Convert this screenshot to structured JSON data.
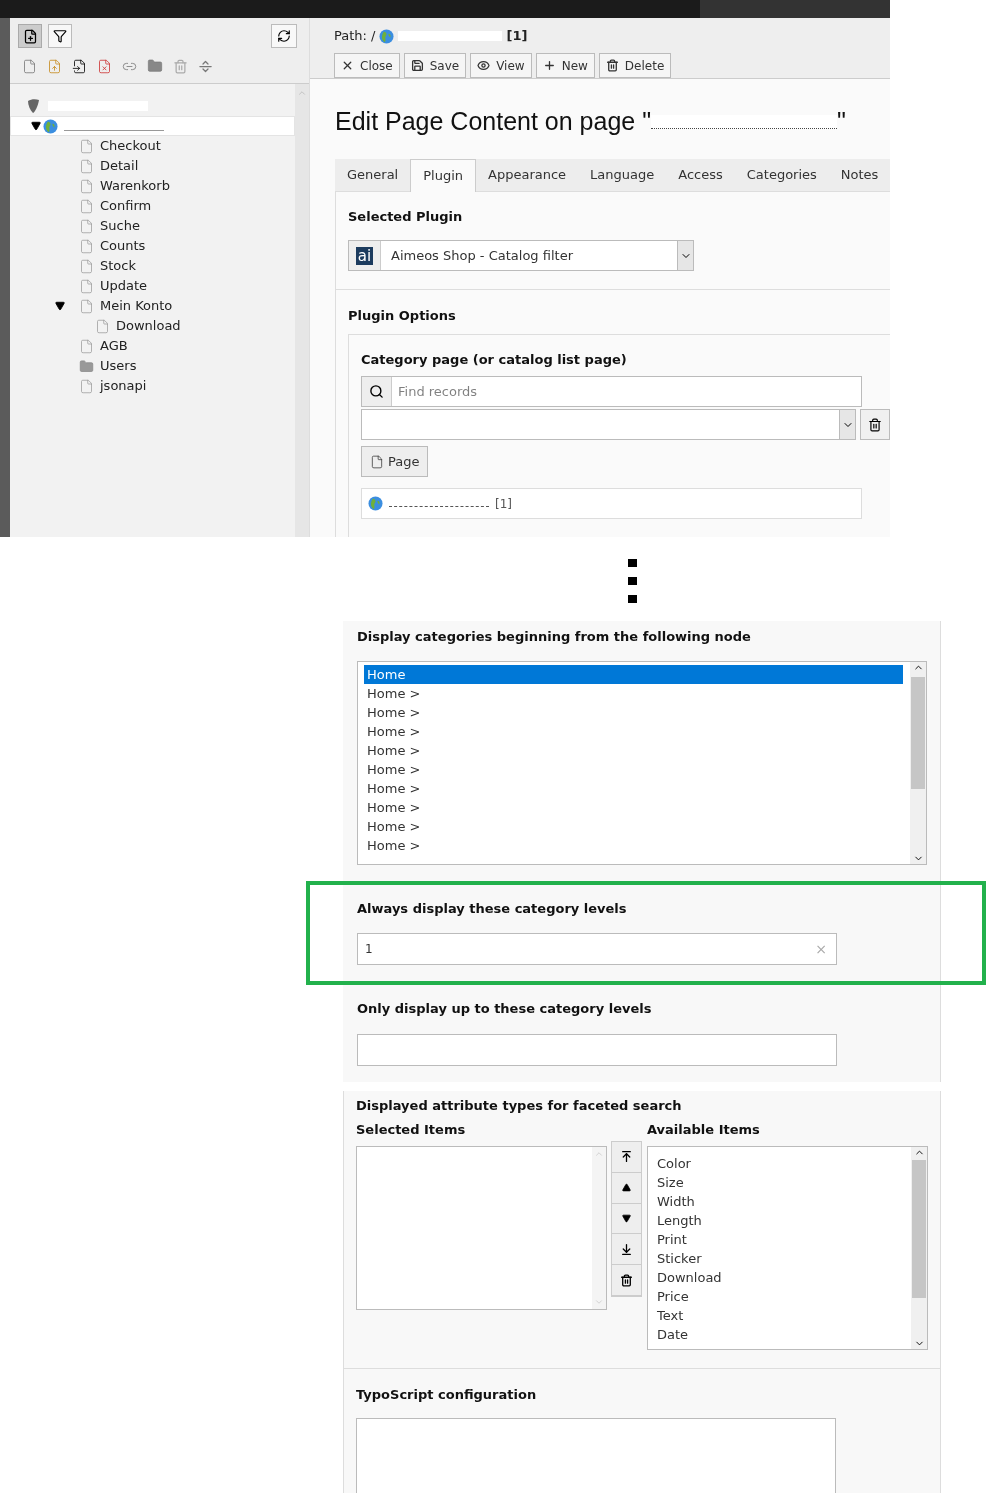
{
  "page_tree": {
    "root_expanded": true,
    "children": [
      {
        "label": "Checkout",
        "kind": "page"
      },
      {
        "label": "Detail",
        "kind": "page"
      },
      {
        "label": "Warenkorb",
        "kind": "page"
      },
      {
        "label": "Confirm",
        "kind": "page"
      },
      {
        "label": "Suche",
        "kind": "page"
      },
      {
        "label": "Counts",
        "kind": "page"
      },
      {
        "label": "Stock",
        "kind": "page"
      },
      {
        "label": "Update",
        "kind": "page"
      },
      {
        "label": "Mein Konto",
        "kind": "page",
        "expanded": true,
        "children": [
          {
            "label": "Download",
            "kind": "page"
          }
        ]
      },
      {
        "label": "AGB",
        "kind": "page"
      },
      {
        "label": "Users",
        "kind": "folder"
      },
      {
        "label": "jsonapi",
        "kind": "page"
      }
    ]
  },
  "docheader": {
    "path_label": "Path: /",
    "path_id": "[1]",
    "buttons": [
      {
        "label": "Close",
        "kind": "close"
      },
      {
        "label": "Save",
        "kind": "save"
      },
      {
        "label": "View",
        "kind": "view"
      },
      {
        "label": "New",
        "kind": "new"
      },
      {
        "label": "Delete",
        "kind": "delete"
      }
    ]
  },
  "heading": {
    "prefix": "Edit Page Content on page \"",
    "suffix": "\""
  },
  "tabs": [
    {
      "label": "General",
      "selected": false
    },
    {
      "label": "Plugin",
      "selected": true
    },
    {
      "label": "Appearance",
      "selected": false
    },
    {
      "label": "Language",
      "selected": false
    },
    {
      "label": "Access",
      "selected": false
    },
    {
      "label": "Categories",
      "selected": false
    },
    {
      "label": "Notes",
      "selected": false
    }
  ],
  "selected_plugin": {
    "label": "Selected Plugin",
    "logo": "ai",
    "value": "Aimeos Shop - Catalog filter"
  },
  "plugin_options": {
    "title": "Plugin Options",
    "category_page": {
      "label": "Category page (or catalog list page)",
      "search_placeholder": "Find records",
      "page_button": "Page",
      "record_id": "[1]"
    }
  },
  "category_node": {
    "label": "Display categories beginning from the following node",
    "options": [
      {
        "text": "Home",
        "selected": true
      },
      {
        "text": "Home >",
        "selected": false
      },
      {
        "text": "Home >",
        "selected": false
      },
      {
        "text": "Home >",
        "selected": false
      },
      {
        "text": "Home >",
        "selected": false
      },
      {
        "text": "Home >",
        "selected": false
      },
      {
        "text": "Home >",
        "selected": false
      },
      {
        "text": "Home >",
        "selected": false
      },
      {
        "text": "Home >",
        "selected": false
      },
      {
        "text": "Home >",
        "selected": false
      }
    ]
  },
  "levels_always": {
    "label": "Always display these category levels",
    "value": "1",
    "clear": "×",
    "highlighted": true
  },
  "levels_max": {
    "label": "Only display up to these category levels"
  },
  "facets": {
    "title": "Displayed attribute types for faceted search",
    "selected_label": "Selected Items",
    "available_label": "Available Items",
    "available": [
      "Color",
      "Size",
      "Width",
      "Length",
      "Print",
      "Sticker",
      "Download",
      "Price",
      "Text",
      "Date"
    ]
  },
  "typoscript": {
    "label": "TypoScript configuration"
  }
}
